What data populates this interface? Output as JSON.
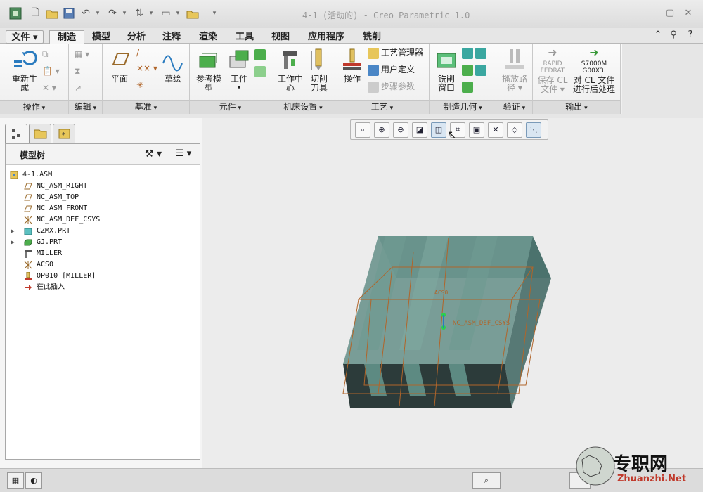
{
  "window": {
    "title": "4-1 (活动的) - Creo Parametric 1.0"
  },
  "menu_tabs": [
    "文件",
    "制造",
    "模型",
    "分析",
    "注释",
    "渲染",
    "工具",
    "视图",
    "应用程序",
    "铣削"
  ],
  "ribbon": {
    "groups": [
      "操作",
      "编辑",
      "基准",
      "元件",
      "机床设置",
      "工艺",
      "制造几何",
      "验证",
      "输出"
    ],
    "regenerate": [
      "重新生",
      "成"
    ],
    "plane": "平面",
    "sketch": "草绘",
    "ref_model": [
      "参考模",
      "型"
    ],
    "workpiece": "工件",
    "work_center": [
      "工作中",
      "心"
    ],
    "cutting_tool": [
      "切削",
      "刀具"
    ],
    "operation": "操作",
    "process_manager": "工艺管理器",
    "user_defined": "用户定义",
    "step_params": "步骤参数",
    "mill_window": [
      "铣削",
      "窗口"
    ],
    "play_path": [
      "播放路",
      "径"
    ],
    "save_file": [
      "保存",
      "文件"
    ],
    "cl_label": "CL",
    "post_process": [
      "对 CL 文件",
      "进行后处理"
    ],
    "rapid_label": [
      "RAPID",
      "FEDRAT"
    ],
    "code_label": [
      "S7000M",
      "G00X3."
    ]
  },
  "panel": {
    "title": "模型树",
    "tree": [
      {
        "label": "4-1.ASM",
        "icon": "assembly-icon",
        "indent": 0
      },
      {
        "label": "NC_ASM_RIGHT",
        "icon": "datum-plane-icon",
        "indent": 1
      },
      {
        "label": "NC_ASM_TOP",
        "icon": "datum-plane-icon",
        "indent": 1
      },
      {
        "label": "NC_ASM_FRONT",
        "icon": "datum-plane-icon",
        "indent": 1
      },
      {
        "label": "NC_ASM_DEF_CSYS",
        "icon": "csys-icon",
        "indent": 1
      },
      {
        "label": "CZMX.PRT",
        "icon": "part-icon",
        "indent": 1,
        "expandable": true
      },
      {
        "label": "GJ.PRT",
        "icon": "workpiece-icon",
        "indent": 1,
        "expandable": true
      },
      {
        "label": "MILLER",
        "icon": "machine-icon",
        "indent": 1
      },
      {
        "label": "ACS0",
        "icon": "csys-icon",
        "indent": 1
      },
      {
        "label": "OP010 [MILLER]",
        "icon": "operation-icon",
        "indent": 1
      },
      {
        "label": "在此插入",
        "icon": "insert-arrow-icon",
        "indent": 1
      }
    ]
  },
  "viewport": {
    "csys_label": "NC_ASM_DEF_CSYS",
    "small_label": "ACS0"
  },
  "watermark": {
    "cn": "专职网",
    "url": "Zhuanzhi.Net"
  },
  "colors": {
    "model_body": "#5d8a82",
    "model_dark": "#2c3b3a",
    "wireframe": "#b0652a",
    "accent": "#2a7bbf"
  }
}
